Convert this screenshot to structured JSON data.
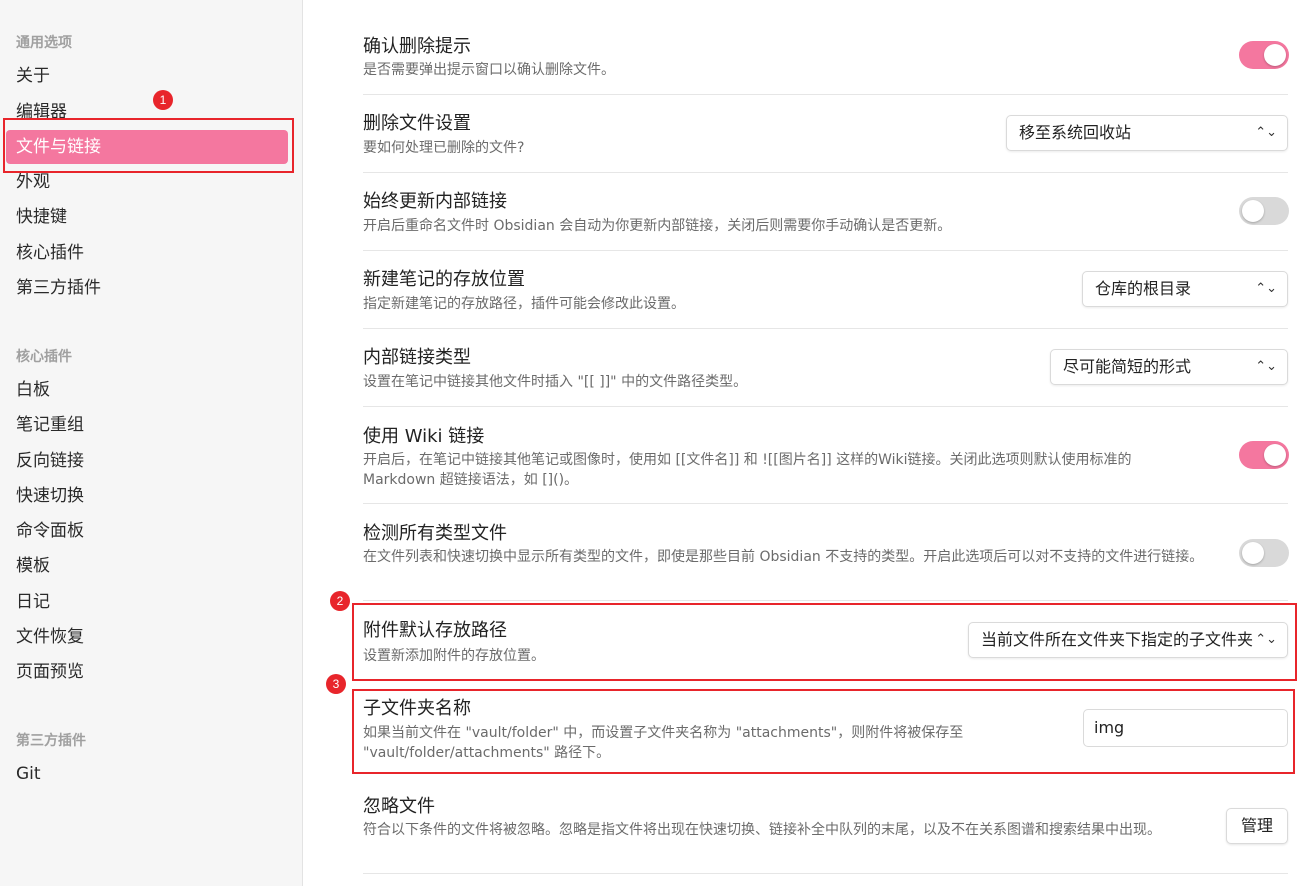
{
  "sidebar": {
    "sections": [
      {
        "heading": "通用选项",
        "items": [
          "关于",
          "编辑器",
          "文件与链接",
          "外观",
          "快捷键",
          "核心插件",
          "第三方插件"
        ]
      },
      {
        "heading": "核心插件",
        "items": [
          "白板",
          "笔记重组",
          "反向链接",
          "快速切换",
          "命令面板",
          "模板",
          "日记",
          "文件恢复",
          "页面预览"
        ]
      },
      {
        "heading": "第三方插件",
        "items": [
          "Git"
        ]
      }
    ],
    "active_item": "文件与链接"
  },
  "settings": [
    {
      "title": "确认删除提示",
      "desc": "是否需要弹出提示窗口以确认删除文件。",
      "control": "toggle",
      "value": true
    },
    {
      "title": "删除文件设置",
      "desc": "要如何处理已删除的文件?",
      "control": "select",
      "value": "移至系统回收站"
    },
    {
      "title": "始终更新内部链接",
      "desc": "开启后重命名文件时 Obsidian 会自动为你更新内部链接，关闭后则需要你手动确认是否更新。",
      "control": "toggle",
      "value": false
    },
    {
      "title": "新建笔记的存放位置",
      "desc": "指定新建笔记的存放路径，插件可能会修改此设置。",
      "control": "select",
      "value": "仓库的根目录"
    },
    {
      "title": "内部链接类型",
      "desc": "设置在笔记中链接其他文件时插入 \"[[ ]]\" 中的文件路径类型。",
      "control": "select",
      "value": "尽可能简短的形式"
    },
    {
      "title": "使用 Wiki 链接",
      "desc": "开启后，在笔记中链接其他笔记或图像时，使用如 [[文件名]] 和 ![[图片名]] 这样的Wiki链接。关闭此选项则默认使用标准的 Markdown 超链接语法，如 []()。",
      "control": "toggle",
      "value": true
    },
    {
      "title": "检测所有类型文件",
      "desc": "在文件列表和快速切换中显示所有类型的文件，即使是那些目前 Obsidian 不支持的类型。开启此选项后可以对不支持的文件进行链接。",
      "control": "toggle",
      "value": false
    },
    {
      "title": "附件默认存放路径",
      "desc": "设置新添加附件的存放位置。",
      "control": "select",
      "value": "当前文件所在文件夹下指定的子文件夹"
    },
    {
      "title": "子文件夹名称",
      "desc": "如果当前文件在 \"vault/folder\" 中，而设置子文件夹名称为 \"attachments\"，则附件将被保存至 \"vault/folder/attachments\" 路径下。",
      "control": "text",
      "value": "img"
    },
    {
      "title": "忽略文件",
      "desc": "符合以下条件的文件将被忽略。忽略是指文件将出现在快速切换、链接补全中队列的末尾，以及不在关系图谱和搜索结果中出现。",
      "control": "button",
      "value": "管理"
    }
  ],
  "annotations": {
    "badge1": "1",
    "badge2": "2",
    "badge3": "3"
  },
  "colors": {
    "accent": "#f4779f",
    "annotation_red": "#e8252b"
  }
}
